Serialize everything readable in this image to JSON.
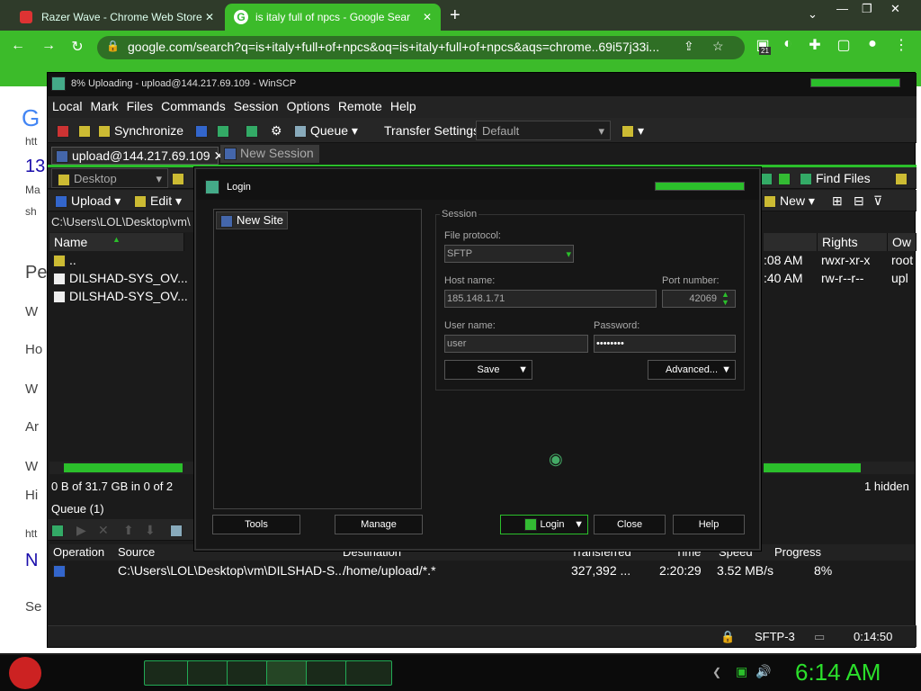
{
  "chrome": {
    "tabs": [
      {
        "title": "Razer Wave - Chrome Web Store",
        "close": "✕"
      },
      {
        "title": "is italy full of npcs - Google Sear",
        "close": "✕"
      }
    ],
    "new_tab": "+",
    "url": "google.com/search?q=is+italy+full+of+npcs&oq=is+italy+full+of+npcs&aqs=chrome..69i57j33i...",
    "ext_badge": "21"
  },
  "google_page": {
    "snippets": [
      "htt",
      "13",
      "Ma",
      "sh",
      "Pe",
      "W",
      "Ho",
      "W",
      "Ar",
      "W",
      "Hi",
      "htt",
      "N",
      "Se"
    ]
  },
  "winscp": {
    "title": "8% Uploading - upload@144.217.69.109 - WinSCP",
    "menu": [
      "Local",
      "Mark",
      "Files",
      "Commands",
      "Session",
      "Options",
      "Remote",
      "Help"
    ],
    "toolbar": {
      "synchronize": "Synchronize",
      "queue": "Queue",
      "transfer_settings_label": "Transfer Settings",
      "transfer_settings_value": "Default"
    },
    "session_tabs": [
      "upload@144.217.69.109",
      "New Session"
    ],
    "local": {
      "drive": "Desktop",
      "upload": "Upload",
      "edit": "Edit",
      "path": "C:\\Users\\LOL\\Desktop\\vm\\",
      "col_name": "Name",
      "rows": [
        {
          "name": ".."
        },
        {
          "name": "DILSHAD-SYS_OV..."
        },
        {
          "name": "DILSHAD-SYS_OV..."
        }
      ],
      "status": "0 B of 31.7 GB in 0 of 2"
    },
    "remote": {
      "find_files": "Find Files",
      "new": "New",
      "col_rights": "Rights",
      "col_owner": "Ow",
      "rows": [
        {
          "changed": ":08 AM",
          "rights": "rwxr-xr-x",
          "owner": "root"
        },
        {
          "changed": ":40 AM",
          "rights": "rw-r--r--",
          "owner": "upl"
        }
      ],
      "status": "1 hidden"
    },
    "queue": {
      "label": "Queue (1)",
      "columns": [
        "Operation",
        "Source",
        "Destination",
        "Transferred",
        "Time",
        "Speed",
        "Progress"
      ],
      "row": {
        "source": "C:\\Users\\LOL\\Desktop\\vm\\DILSHAD-S...",
        "destination": "/home/upload/*.*",
        "transferred": "327,392 ...",
        "time": "2:20:29",
        "speed": "3.52 MB/s",
        "progress": "8%"
      }
    },
    "statusbar": {
      "protocol": "SFTP-3",
      "elapsed": "0:14:50"
    }
  },
  "login": {
    "title": "Login",
    "site": "New Site",
    "session_group": "Session",
    "file_protocol_label": "File protocol:",
    "file_protocol": "SFTP",
    "host_label": "Host name:",
    "host": "185.148.1.71",
    "port_label": "Port number:",
    "port": "42069",
    "user_label": "User name:",
    "user": "user",
    "password_label": "Password:",
    "password": "••••••••",
    "save": "Save",
    "advanced": "Advanced...",
    "tools": "Tools",
    "manage": "Manage",
    "login": "Login",
    "close": "Close",
    "help": "Help"
  },
  "taskbar": {
    "clock": "6:14 AM"
  }
}
